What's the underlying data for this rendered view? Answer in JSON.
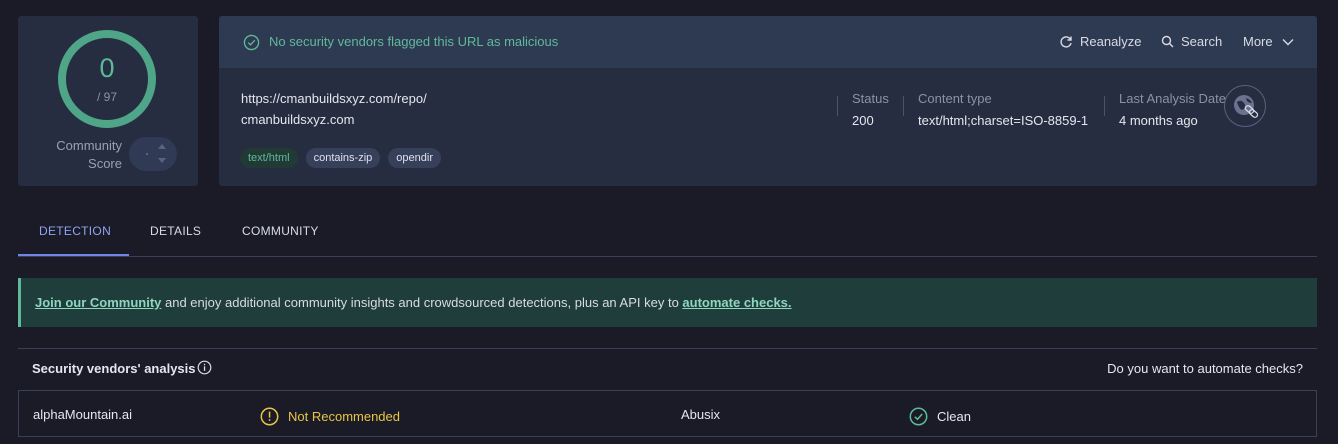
{
  "score": {
    "detections": "0",
    "total": "/ 97",
    "community_label_1": "Community",
    "community_label_2": "Score"
  },
  "banner": {
    "message": "No security vendors flagged this URL as malicious",
    "reanalyze": "Reanalyze",
    "search": "Search",
    "more": "More"
  },
  "url": {
    "full": "https://cmanbuildsxyz.com/repo/",
    "domain": "cmanbuildsxyz.com",
    "tags": [
      "text/html",
      "contains-zip",
      "opendir"
    ]
  },
  "meta": {
    "status_label": "Status",
    "status_value": "200",
    "content_type_label": "Content type",
    "content_type_value": "text/html;charset=ISO-8859-1",
    "last_analysis_label": "Last Analysis Date",
    "last_analysis_value": "4 months ago"
  },
  "tabs": [
    "DETECTION",
    "DETAILS",
    "COMMUNITY"
  ],
  "community_banner": {
    "link1": "Join our Community",
    "middle": " and enjoy additional community insights and crowdsourced detections, plus an API key to ",
    "link2": "automate checks."
  },
  "vendors": {
    "title": "Security vendors' analysis",
    "automate": "Do you want to automate checks?",
    "rows": [
      {
        "left_name": "alphaMountain.ai",
        "left_result": "Not Recommended",
        "right_name": "Abusix",
        "right_result": "Clean"
      }
    ]
  },
  "colors": {
    "background": "#1a1b26",
    "card": "#262d40",
    "clean_green": "#5fba9a",
    "warning_yellow": "#e8c547",
    "accent_blue": "#8fa4f0"
  }
}
